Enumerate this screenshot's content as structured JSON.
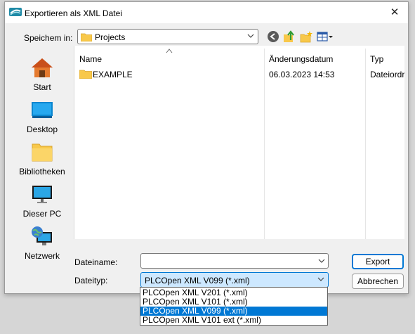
{
  "window": {
    "title": "Exportieren als XML Datei"
  },
  "save_in": {
    "label": "Speichem in:",
    "value": "Projects"
  },
  "toolbar": {
    "icons": [
      "back-icon",
      "up-folder-icon",
      "new-folder-icon",
      "view-menu-icon"
    ]
  },
  "places": [
    {
      "label": "Start",
      "icon": "home-icon"
    },
    {
      "label": "Desktop",
      "icon": "desktop-icon"
    },
    {
      "label": "Bibliotheken",
      "icon": "libraries-icon"
    },
    {
      "label": "Dieser PC",
      "icon": "this-pc-icon"
    },
    {
      "label": "Netzwerk",
      "icon": "network-icon"
    }
  ],
  "file_list": {
    "columns": [
      "Name",
      "Änderungsdatum",
      "Typ"
    ],
    "rows": [
      {
        "name": "EXAMPLE",
        "date": "06.03.2023 14:53",
        "type": "Dateiordr"
      }
    ]
  },
  "filename": {
    "label": "Dateiname:",
    "value": ""
  },
  "filetype": {
    "label": "Dateityp:",
    "value": "PLCOpen XML V099 (*.xml)",
    "options": [
      "PLCOpen XML V201 (*.xml)",
      "PLCOpen XML V101 (*.xml)",
      "PLCOpen XML V099 (*.xml)",
      "PLCOpen XML V101 ext (*.xml)"
    ],
    "selected_index": 2
  },
  "buttons": {
    "export": "Export",
    "cancel": "Abbrechen"
  },
  "colors": {
    "accent": "#0078d4",
    "selection_bg": "#cde8ff",
    "folder": "#f8c84a"
  }
}
